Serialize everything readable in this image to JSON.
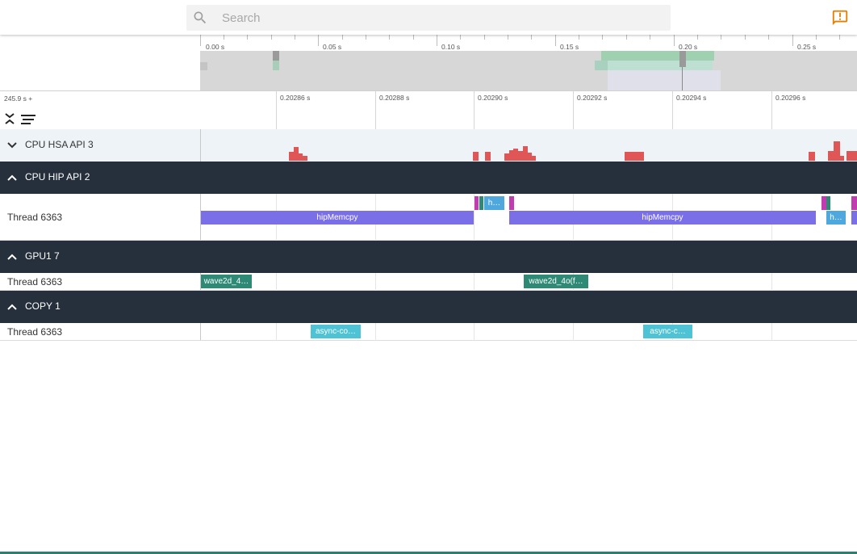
{
  "search": {
    "placeholder": "Search"
  },
  "overview": {
    "ticks": [
      "0.00 s",
      "0.05 s",
      "0.10 s",
      "0.15 s",
      "0.20 s",
      "0.25 s"
    ]
  },
  "axis": {
    "offset": "245.9 s +",
    "ticks": [
      "0.20286 s",
      "0.20288 s",
      "0.20290 s",
      "0.20292 s",
      "0.20294 s",
      "0.20296 s"
    ]
  },
  "tracks": {
    "hsa": {
      "title": "CPU HSA API 3"
    },
    "hip": {
      "title": "CPU HIP API 2",
      "thread": "Thread 6363",
      "slices": [
        "hipMemcpy",
        "hipMemcpy",
        "h…",
        "h…"
      ]
    },
    "gpu": {
      "title": "GPU1 7",
      "thread": "Thread 6363",
      "slices": [
        "wave2d_4…",
        "wave2d_4o(f…"
      ]
    },
    "copy": {
      "title": "COPY 1",
      "thread": "Thread 6363",
      "slices": [
        "async-co…",
        "async-c…"
      ]
    }
  },
  "colors": {
    "group_bg": "#262f3c",
    "hip_slice": "#7b6fe8",
    "gpu_slice": "#2e8a75",
    "copy_slice": "#4fc3d6",
    "hsa_bar": "#e05555",
    "feedback_icon": "#e67e00"
  }
}
